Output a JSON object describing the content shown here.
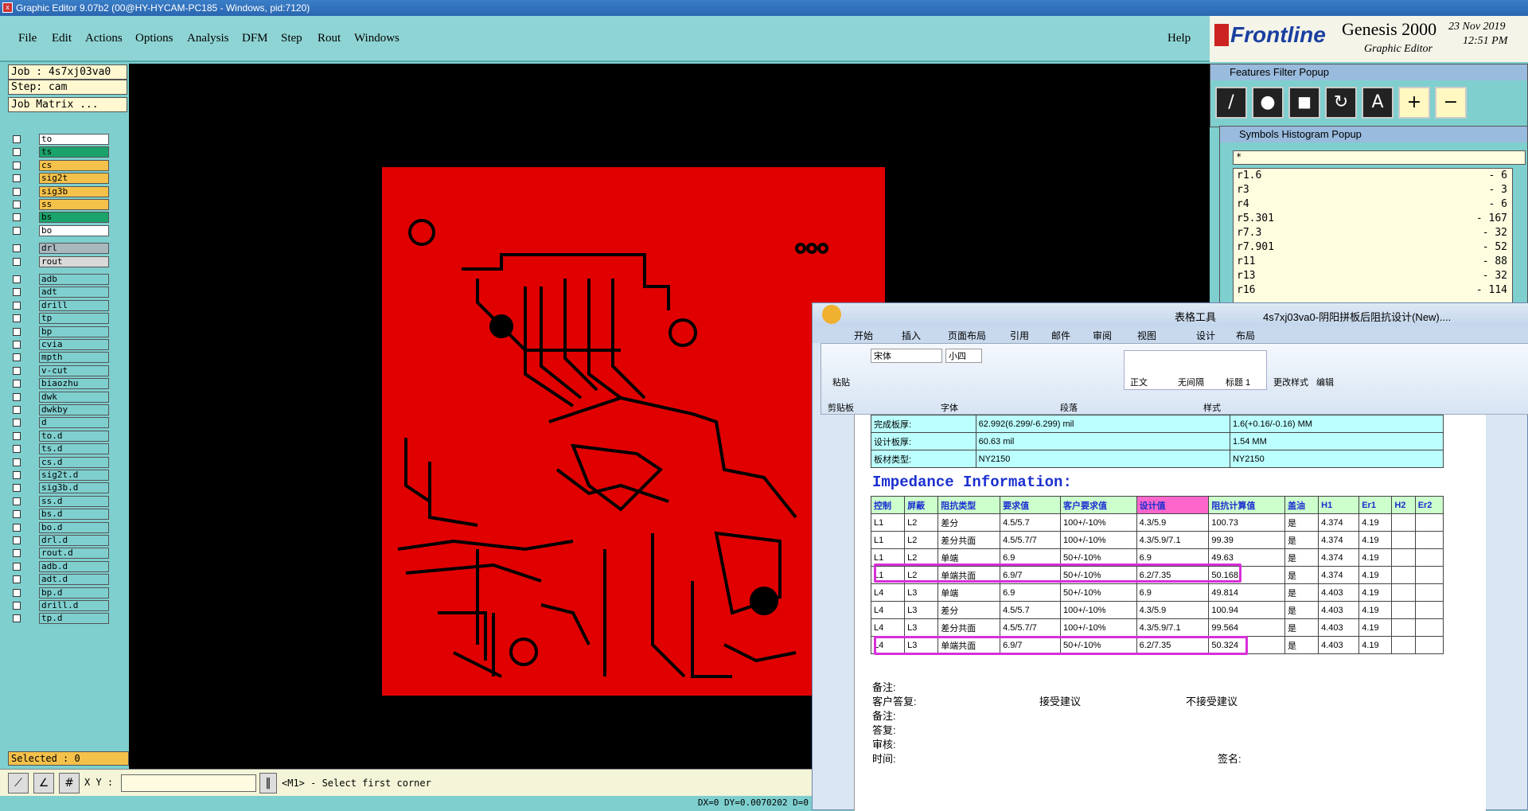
{
  "window": {
    "title": "Graphic Editor 9.07b2 (00@HY-HYCAM-PC185 - Windows, pid:7120)"
  },
  "menu": [
    "File",
    "Edit",
    "Actions",
    "Options",
    "Analysis",
    "DFM",
    "Step",
    "Rout",
    "Windows"
  ],
  "help": "Help",
  "brand": {
    "logo": "Frontline",
    "product": "Genesis 2000",
    "sub": "Graphic Editor",
    "date": "23 Nov 2019",
    "time": "12:51 PM"
  },
  "job": {
    "job": "Job : 4s7xj03va0",
    "step": "Step: cam",
    "matrix": "Job Matrix ..."
  },
  "layers": [
    {
      "n": "to",
      "c": "#ffffff"
    },
    {
      "n": "ts",
      "c": "#1aa36b"
    },
    {
      "n": "cs",
      "c": "#f4c14a"
    },
    {
      "n": "sig2t",
      "c": "#f4c14a"
    },
    {
      "n": "sig3b",
      "c": "#f4c14a"
    },
    {
      "n": "ss",
      "c": "#f4c14a"
    },
    {
      "n": "bs",
      "c": "#1aa36b"
    },
    {
      "n": "bo",
      "c": "#ffffff"
    },
    {
      "n": "drl",
      "c": "#a9b8bf"
    },
    {
      "n": "rout",
      "c": "#d9d9d9"
    },
    {
      "n": "adb",
      "c": "#7fcfcf"
    },
    {
      "n": "adt",
      "c": "#7fcfcf"
    },
    {
      "n": "drill",
      "c": "#7fcfcf"
    },
    {
      "n": "tp",
      "c": "#7fcfcf"
    },
    {
      "n": "bp",
      "c": "#7fcfcf"
    },
    {
      "n": "cvia",
      "c": "#7fcfcf"
    },
    {
      "n": "mpth",
      "c": "#7fcfcf"
    },
    {
      "n": "v-cut",
      "c": "#7fcfcf"
    },
    {
      "n": "biaozhu",
      "c": "#7fcfcf"
    },
    {
      "n": "dwk",
      "c": "#7fcfcf"
    },
    {
      "n": "dwkby",
      "c": "#7fcfcf"
    },
    {
      "n": "d",
      "c": "#7fcfcf"
    },
    {
      "n": "to.d",
      "c": "#7fcfcf"
    },
    {
      "n": "ts.d",
      "c": "#7fcfcf"
    },
    {
      "n": "cs.d",
      "c": "#7fcfcf"
    },
    {
      "n": "sig2t.d",
      "c": "#7fcfcf"
    },
    {
      "n": "sig3b.d",
      "c": "#7fcfcf"
    },
    {
      "n": "ss.d",
      "c": "#7fcfcf"
    },
    {
      "n": "bs.d",
      "c": "#7fcfcf"
    },
    {
      "n": "bo.d",
      "c": "#7fcfcf"
    },
    {
      "n": "drl.d",
      "c": "#7fcfcf"
    },
    {
      "n": "rout.d",
      "c": "#7fcfcf"
    },
    {
      "n": "adb.d",
      "c": "#7fcfcf"
    },
    {
      "n": "adt.d",
      "c": "#7fcfcf"
    },
    {
      "n": "bp.d",
      "c": "#7fcfcf"
    },
    {
      "n": "drill.d",
      "c": "#7fcfcf"
    },
    {
      "n": "tp.d",
      "c": "#7fcfcf"
    }
  ],
  "selected": "Selected : 0",
  "xy_label": "X Y :",
  "prompt": "<M1> - Select first corner",
  "status": "DX=0 DY=0.0070202 D=0",
  "features_popup": {
    "title": "Features Filter Popup"
  },
  "symbols_popup": {
    "title": "Symbols Histogram Popup",
    "filter": "*",
    "rows": [
      {
        "s": "r1.6",
        "v": "- 6"
      },
      {
        "s": "r3",
        "v": "- 3"
      },
      {
        "s": "r4",
        "v": "- 6"
      },
      {
        "s": "r5.301",
        "v": "- 167"
      },
      {
        "s": "r7.3",
        "v": "- 32"
      },
      {
        "s": "r7.901",
        "v": "- 52"
      },
      {
        "s": "r11",
        "v": "- 88"
      },
      {
        "s": "r13",
        "v": "- 32"
      },
      {
        "s": "r16",
        "v": "- 114"
      }
    ]
  },
  "word": {
    "title": "4s7xj03va0-阴阳拼板后阻抗设计(New)....",
    "context": "表格工具",
    "tabs": [
      "开始",
      "插入",
      "页面布局",
      "引用",
      "邮件",
      "审阅",
      "视图",
      "设计",
      "布局"
    ],
    "font": "宋体",
    "size": "小四",
    "groups": [
      "剪贴板",
      "字体",
      "段落",
      "样式",
      "编辑"
    ],
    "styles": [
      "正文",
      "无间隔",
      "标题 1"
    ],
    "paste": "粘贴",
    "edit": "编辑",
    "change_styles": "更改样式",
    "top_rows": [
      [
        "完成板厚:",
        "62.992(6.299/-6.299) mil",
        "1.6(+0.16/-0.16) MM"
      ],
      [
        "设计板厚:",
        "60.63 mil",
        "1.54 MM"
      ],
      [
        "板材类型:",
        "NY2150",
        "NY2150"
      ]
    ],
    "imp_title": "Impedance Information:",
    "headers": [
      "控制",
      "屏蔽",
      "阻抗类型",
      "要求值",
      "客户要求值",
      "设计值",
      "阻抗计算值",
      "盖油",
      "H1",
      "Er1",
      "H2",
      "Er2"
    ],
    "rows": [
      [
        "L1",
        "L2",
        "差分",
        "4.5/5.7",
        "100+/-10%",
        "4.3/5.9",
        "100.73",
        "是",
        "4.374",
        "4.19",
        "",
        ""
      ],
      [
        "L1",
        "L2",
        "差分共面",
        "4.5/5.7/7",
        "100+/-10%",
        "4.3/5.9/7.1",
        "99.39",
        "是",
        "4.374",
        "4.19",
        "",
        ""
      ],
      [
        "L1",
        "L2",
        "单端",
        "6.9",
        "50+/-10%",
        "6.9",
        "49.63",
        "是",
        "4.374",
        "4.19",
        "",
        ""
      ],
      [
        "L1",
        "L2",
        "单端共面",
        "6.9/7",
        "50+/-10%",
        "6.2/7.35",
        "50.168",
        "是",
        "4.374",
        "4.19",
        "",
        ""
      ],
      [
        "L4",
        "L3",
        "单端",
        "6.9",
        "50+/-10%",
        "6.9",
        "49.814",
        "是",
        "4.403",
        "4.19",
        "",
        ""
      ],
      [
        "L4",
        "L3",
        "差分",
        "4.5/5.7",
        "100+/-10%",
        "4.3/5.9",
        "100.94",
        "是",
        "4.403",
        "4.19",
        "",
        ""
      ],
      [
        "L4",
        "L3",
        "差分共面",
        "4.5/5.7/7",
        "100+/-10%",
        "4.3/5.9/7.1",
        "99.564",
        "是",
        "4.403",
        "4.19",
        "",
        ""
      ],
      [
        "L4",
        "L3",
        "单端共面",
        "6.9/7",
        "50+/-10%",
        "6.2/7.35",
        "50.324",
        "是",
        "4.403",
        "4.19",
        "",
        ""
      ]
    ],
    "notes": [
      "备注:",
      "客户答复:",
      "接受建议",
      "不接受建议",
      "备注:",
      "答复:",
      "审核:",
      "时间:",
      "签名:"
    ]
  }
}
